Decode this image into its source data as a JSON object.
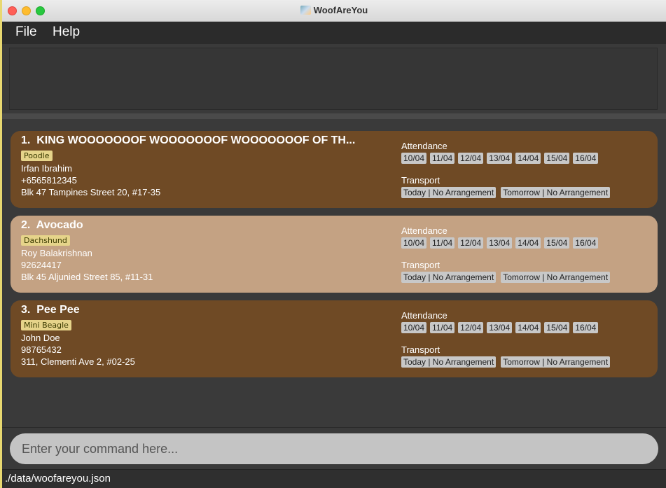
{
  "window": {
    "title": "WoofAreYou"
  },
  "menu": {
    "file": "File",
    "help": "Help"
  },
  "result_display": "",
  "pets": [
    {
      "index": "1.",
      "name": "KING WOOOOOOOF WOOOOOOOF WOOOOOOOF OF TH...",
      "breed": "Poodle",
      "owner": "Irfan Ibrahim",
      "phone": "+6565812345",
      "address": "Blk 47 Tampines Street 20, #17-35",
      "attendance_label": "Attendance",
      "dates": [
        "10/04",
        "11/04",
        "12/04",
        "13/04",
        "14/04",
        "15/04",
        "16/04"
      ],
      "transport_label": "Transport",
      "transport": [
        "Today | No Arrangement",
        "Tomorrow | No Arrangement"
      ]
    },
    {
      "index": "2.",
      "name": "Avocado",
      "breed": "Dachshund",
      "owner": "Roy Balakrishnan",
      "phone": "92624417",
      "address": "Blk 45 Aljunied Street 85, #11-31",
      "attendance_label": "Attendance",
      "dates": [
        "10/04",
        "11/04",
        "12/04",
        "13/04",
        "14/04",
        "15/04",
        "16/04"
      ],
      "transport_label": "Transport",
      "transport": [
        "Today | No Arrangement",
        "Tomorrow | No Arrangement"
      ]
    },
    {
      "index": "3.",
      "name": "Pee Pee",
      "breed": "Mini Beagle",
      "owner": "John Doe",
      "phone": "98765432",
      "address": "311, Clementi Ave 2, #02-25",
      "attendance_label": "Attendance",
      "dates": [
        "10/04",
        "11/04",
        "12/04",
        "13/04",
        "14/04",
        "15/04",
        "16/04"
      ],
      "transport_label": "Transport",
      "transport": [
        "Today | No Arrangement",
        "Tomorrow | No Arrangement"
      ]
    }
  ],
  "command": {
    "placeholder": "Enter your command here..."
  },
  "status": {
    "path": "./data/woofareyou.json"
  },
  "colors": {
    "card_dark": "#6f4a25",
    "card_light": "#c4a283",
    "breed_tag": "#e6d48a",
    "background": "#3a3a3a"
  }
}
